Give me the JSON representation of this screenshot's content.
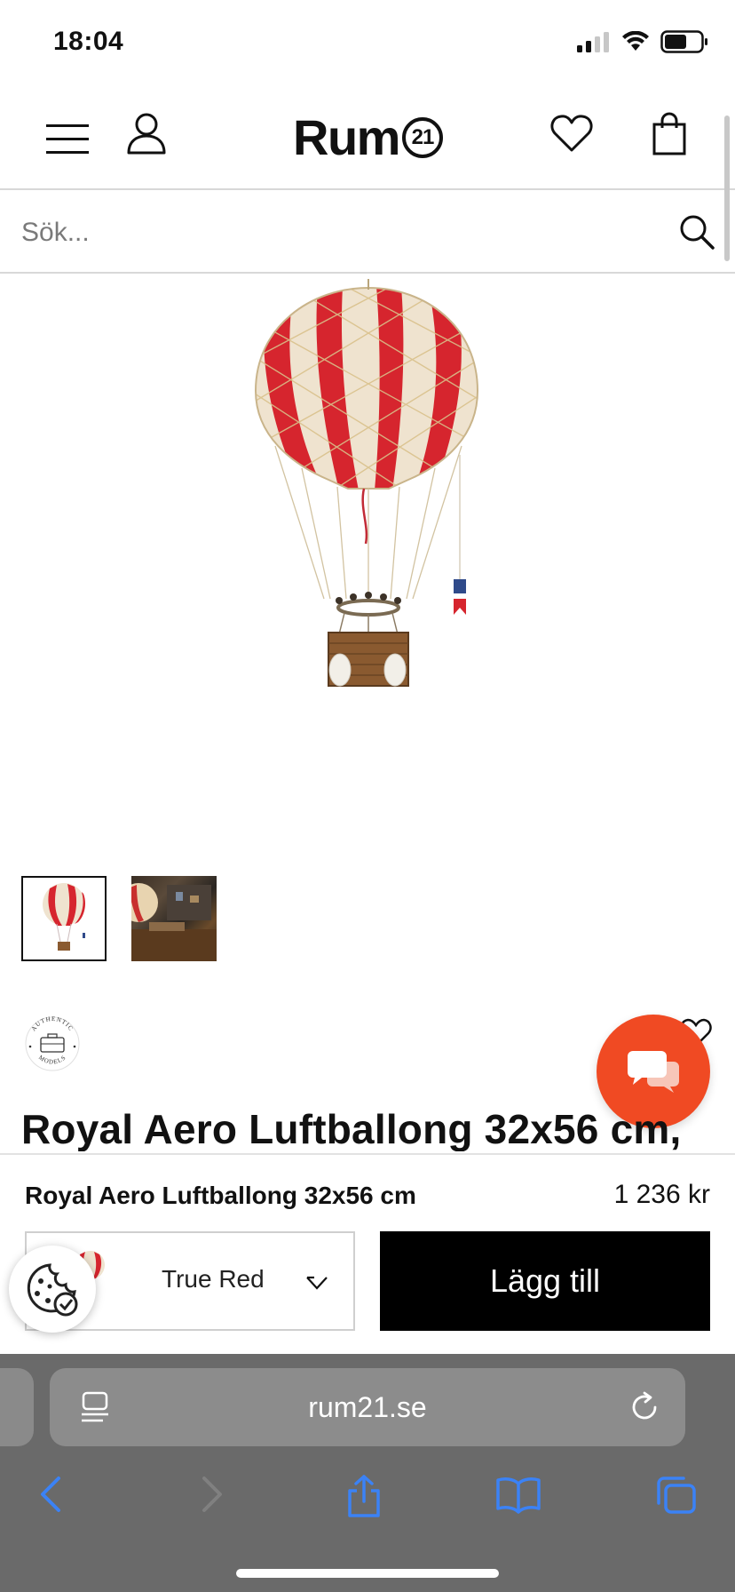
{
  "status_bar": {
    "time": "18:04"
  },
  "header": {
    "logo_text": "Rum",
    "logo_number": "21"
  },
  "search": {
    "placeholder": "Sök..."
  },
  "product": {
    "title": "Royal Aero Luftballong 32x56 cm,",
    "image_alt": "Royal Aero Luftballong True Red",
    "thumbnails": [
      "balloon-product",
      "balloon-lifestyle"
    ],
    "brand_badge": "AUTHENTIC MODELS"
  },
  "sticky_bar": {
    "name": "Royal Aero Luftballong 32x56 cm",
    "price": "1 236 kr",
    "variant": "True Red",
    "add_label": "Lägg till"
  },
  "browser": {
    "url": "rum21.se"
  },
  "colors": {
    "accent": "#f04a23",
    "balloon_red": "#d6252e",
    "button_black": "#000000",
    "browser_gray": "#6a6a6a",
    "link_blue": "#3b82f6"
  }
}
